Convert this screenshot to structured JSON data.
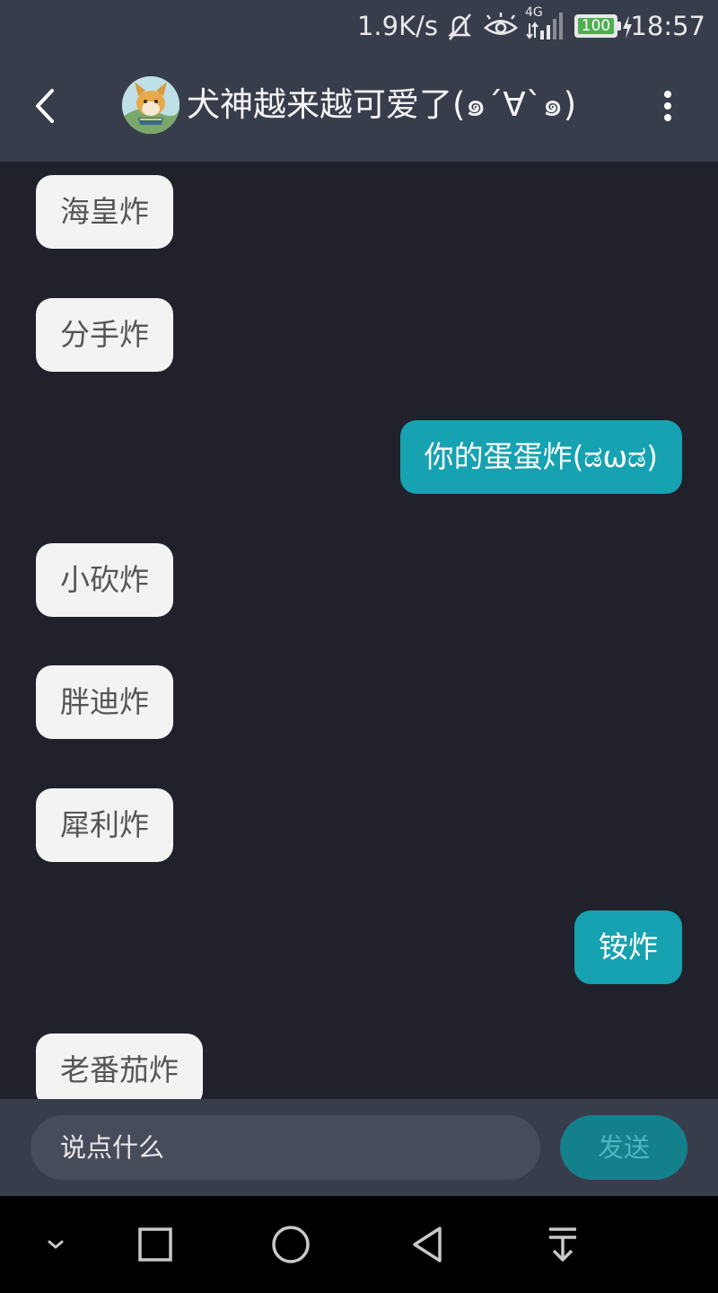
{
  "status_bar": {
    "net_speed": "1.9K/s",
    "network_label": "4G",
    "battery": "100",
    "time": "18:57",
    "icons": [
      "mute-icon",
      "eye-icon",
      "signal-icon",
      "battery-icon",
      "charging-icon"
    ]
  },
  "header": {
    "title": "犬神越来越可爱了(๑´∀`๑)",
    "icons": [
      "back-arrow-icon",
      "avatar",
      "more-vertical-icon"
    ]
  },
  "messages": [
    {
      "side": "in",
      "text": "海皇炸"
    },
    {
      "side": "in",
      "text": "分手炸"
    },
    {
      "side": "out",
      "text": "你的蛋蛋炸(ಡωಡ)"
    },
    {
      "side": "in",
      "text": "小砍炸"
    },
    {
      "side": "in",
      "text": "胖迪炸"
    },
    {
      "side": "in",
      "text": "犀利炸"
    },
    {
      "side": "out",
      "text": "铵炸"
    },
    {
      "side": "in",
      "text": "老番茄炸"
    }
  ],
  "input": {
    "placeholder": "说点什么",
    "send_label": "发送"
  },
  "nav_bar": {
    "icons": [
      "chevron-down-icon",
      "recents-square-icon",
      "home-circle-icon",
      "back-triangle-icon",
      "notification-pull-icon"
    ]
  },
  "colors": {
    "background": "#20212b",
    "header_bg": "#383d4b",
    "incoming_bubble": "#f3f3f3",
    "outgoing_bubble": "#16a2b0",
    "send_button": "#13808c"
  }
}
